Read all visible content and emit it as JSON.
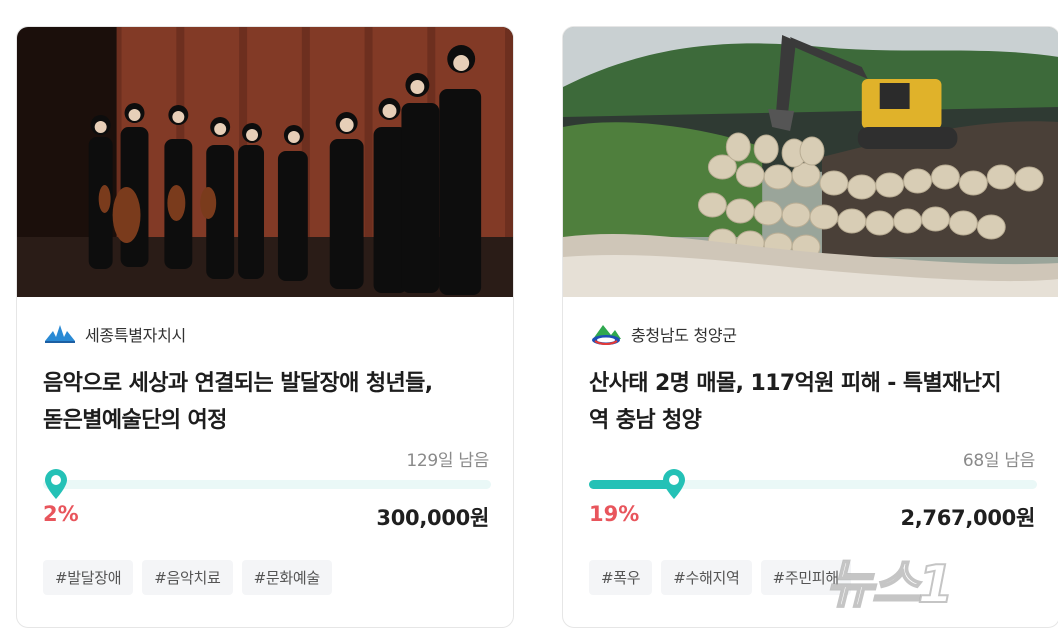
{
  "cards": [
    {
      "image_alt": "photo-musicians-on-stage",
      "org_name": "세종특별자치시",
      "org_icon": "sejong-logo-icon",
      "title_line1": "음악으로 세상과 연결되는 발달장애 청년들,",
      "title_line2": "돋은별예술단의 여정",
      "remaining": "129일 남음",
      "progress": 0.02,
      "percent_label": "2%",
      "amount": "300,000원",
      "tags": [
        "#발달장애",
        "#음악치료",
        "#문화예술"
      ]
    },
    {
      "image_alt": "photo-sandbag-flood-barrier",
      "org_name": "충청남도 청양군",
      "org_icon": "cheongyang-logo-icon",
      "title_line1": "산사태 2명 매몰, 117억원 피해 - 특별재난지",
      "title_line2": "역 충남 청양",
      "remaining": "68일 남음",
      "progress": 0.19,
      "percent_label": "19%",
      "amount": "2,767,000원",
      "tags": [
        "#폭우",
        "#수해지역",
        "#주민피해"
      ]
    }
  ],
  "watermark": {
    "text": "뉴스1"
  },
  "colors": {
    "accent": "#24c1b6",
    "track": "#eaf8f7",
    "percent": "#e8555c"
  }
}
